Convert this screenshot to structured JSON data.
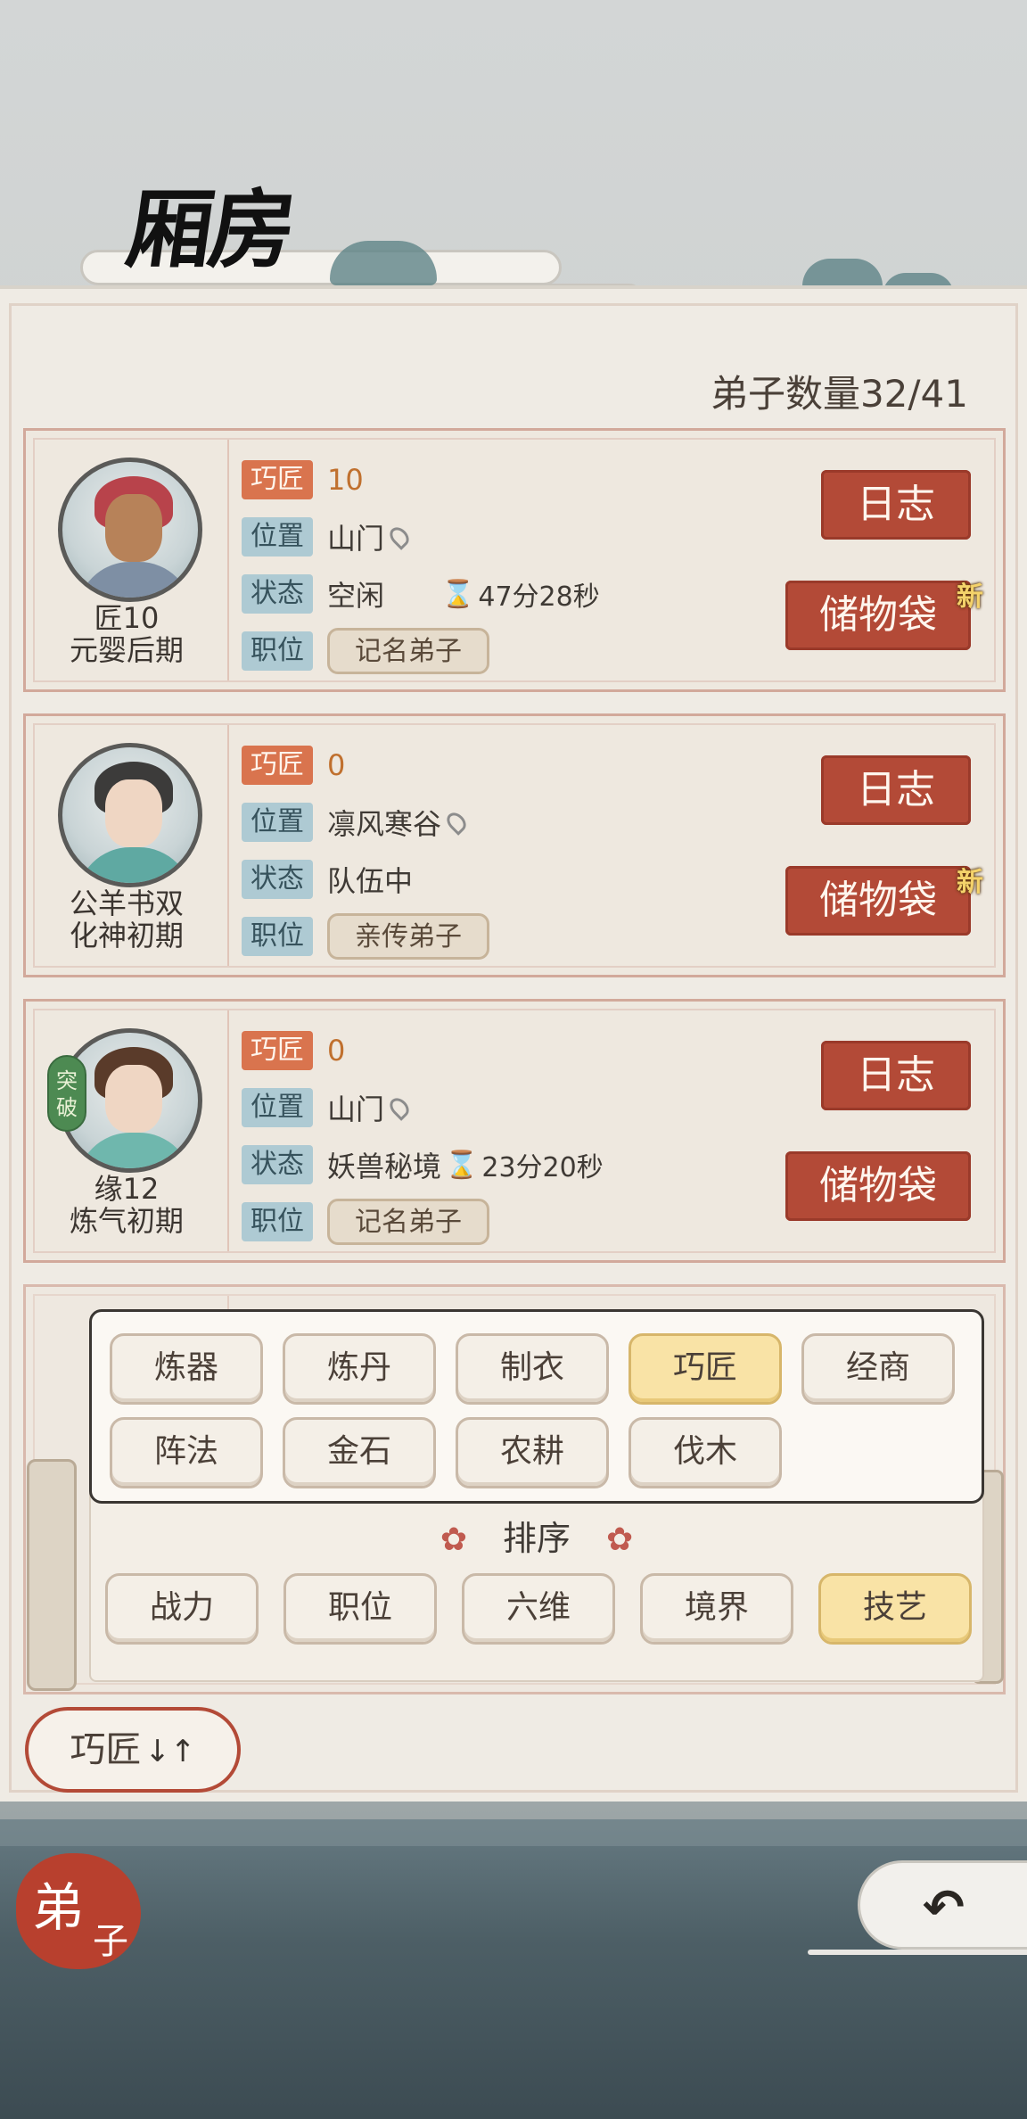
{
  "header": {
    "title": "厢房"
  },
  "disciple_count": "弟子数量32/41",
  "labels": {
    "skill": "巧匠",
    "location": "位置",
    "status": "状态",
    "position": "职位",
    "log": "日志",
    "bag": "储物袋",
    "new": "新",
    "hourglass": "⌛"
  },
  "disciples": [
    {
      "name": "匠10",
      "realm": "元婴后期",
      "skill_value": "10",
      "location": "山门",
      "status": "空闲",
      "timer": "47分28秒",
      "rank": "记名弟子",
      "bag_new": true
    },
    {
      "name": "公羊书双",
      "realm": "化神初期",
      "skill_value": "0",
      "location": "凛风寒谷",
      "status": "队伍中",
      "timer": "",
      "rank": "亲传弟子",
      "bag_new": true
    },
    {
      "name": "缘12",
      "realm": "炼气初期",
      "skill_value": "0",
      "location": "山门",
      "status": "妖兽秘境",
      "timer": "23分20秒",
      "rank": "记名弟子",
      "bag_new": false,
      "breakthrough": "突破"
    }
  ],
  "filters": {
    "items": [
      "炼器",
      "炼丹",
      "制衣",
      "巧匠",
      "经商",
      "阵法",
      "金石",
      "农耕",
      "伐木"
    ],
    "selected": "巧匠"
  },
  "sort": {
    "title": "排序",
    "items": [
      "战力",
      "职位",
      "六维",
      "境界",
      "技艺"
    ],
    "selected": "技艺"
  },
  "sort_button": {
    "label": "巧匠",
    "arrows": "↓↑"
  },
  "nav": {
    "disciple_a": "弟",
    "disciple_b": "子",
    "back_icon": "↶"
  },
  "colors": {
    "accent_red": "#b34a37",
    "tag_orange": "#d9744e",
    "tag_blue": "#aecad3",
    "selected_chip": "#f9e3a6"
  }
}
